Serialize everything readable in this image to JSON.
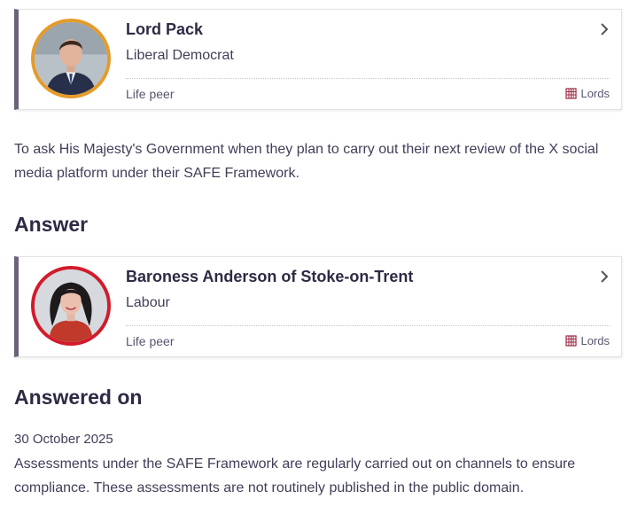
{
  "asker": {
    "name": "Lord Pack",
    "party": "Liberal Democrat",
    "status": "Life peer",
    "house": "Lords",
    "party_color": "#e59b2b"
  },
  "question_text": "To ask His Majesty's Government when they plan to carry out their next review of the X social media platform under their SAFE Framework.",
  "answer_heading": "Answer",
  "answerer": {
    "name": "Baroness Anderson of Stoke-on-Trent",
    "party": "Labour",
    "status": "Life peer",
    "house": "Lords",
    "party_color": "#d21b2b"
  },
  "answered_on_heading": "Answered on",
  "answered_date": "30 October 2025",
  "answer_text": "Assessments under the SAFE Framework are regularly carried out on channels to ensure compliance. These assessments are not routinely published in the public domain.",
  "icons": {
    "chevron": "chevron-right-icon",
    "house": "portcullis-icon"
  },
  "colors": {
    "card_accent": "#6c6379",
    "house_lords": "#9b2743"
  }
}
